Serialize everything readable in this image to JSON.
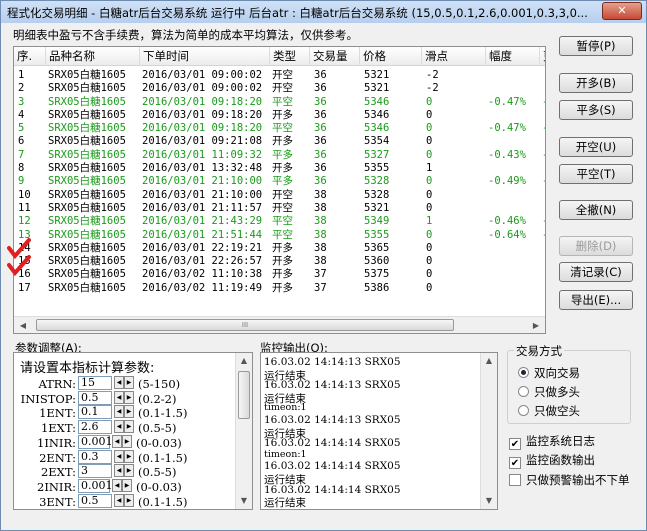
{
  "window": {
    "title": "程式化交易明细 - 白糖atr后台交易系统 运行中 后台atr : 白糖atr后台交易系统 (15,0.5,0.1,2.6,0.001,0.3,3,0...",
    "close": "✕"
  },
  "note": "明细表中盈亏不含手续费，算法为简单的成本平均算法，仅供参考。",
  "table": {
    "headers": [
      "序.",
      "品种名称",
      "下单时间",
      "类型",
      "交易量",
      "价格",
      "滑点",
      "幅度",
      "更"
    ],
    "rows": [
      {
        "n": "1",
        "name": "SRX05白糖1605",
        "time": "2016/03/01 09:00:02",
        "type": "开空",
        "qty": "36",
        "price": "5321",
        "slip": "-2",
        "pct": "",
        "green": false
      },
      {
        "n": "2",
        "name": "SRX05白糖1605",
        "time": "2016/03/01 09:00:02",
        "type": "开空",
        "qty": "36",
        "price": "5321",
        "slip": "-2",
        "pct": "",
        "green": false
      },
      {
        "n": "3",
        "name": "SRX05白糖1605",
        "time": "2016/03/01 09:18:20",
        "type": "平空",
        "qty": "36",
        "price": "5346",
        "slip": "0",
        "pct": "-0.47%",
        "green": true
      },
      {
        "n": "4",
        "name": "SRX05白糖1605",
        "time": "2016/03/01 09:18:20",
        "type": "开多",
        "qty": "36",
        "price": "5346",
        "slip": "0",
        "pct": "",
        "green": false
      },
      {
        "n": "5",
        "name": "SRX05白糖1605",
        "time": "2016/03/01 09:18:20",
        "type": "平空",
        "qty": "36",
        "price": "5346",
        "slip": "0",
        "pct": "-0.47%",
        "green": true
      },
      {
        "n": "6",
        "name": "SRX05白糖1605",
        "time": "2016/03/01 09:21:08",
        "type": "开多",
        "qty": "36",
        "price": "5354",
        "slip": "0",
        "pct": "",
        "green": false
      },
      {
        "n": "7",
        "name": "SRX05白糖1605",
        "time": "2016/03/01 11:09:32",
        "type": "平多",
        "qty": "36",
        "price": "5327",
        "slip": "0",
        "pct": "-0.43%",
        "green": true
      },
      {
        "n": "8",
        "name": "SRX05白糖1605",
        "time": "2016/03/01 13:32:48",
        "type": "开多",
        "qty": "36",
        "price": "5355",
        "slip": "1",
        "pct": "",
        "green": false
      },
      {
        "n": "9",
        "name": "SRX05白糖1605",
        "time": "2016/03/01 21:10:00",
        "type": "平多",
        "qty": "36",
        "price": "5328",
        "slip": "0",
        "pct": "-0.49%",
        "green": true
      },
      {
        "n": "10",
        "name": "SRX05白糖1605",
        "time": "2016/03/01 21:10:00",
        "type": "开空",
        "qty": "38",
        "price": "5328",
        "slip": "0",
        "pct": "",
        "green": false
      },
      {
        "n": "11",
        "name": "SRX05白糖1605",
        "time": "2016/03/01 21:11:57",
        "type": "开空",
        "qty": "38",
        "price": "5321",
        "slip": "0",
        "pct": "",
        "green": false
      },
      {
        "n": "12",
        "name": "SRX05白糖1605",
        "time": "2016/03/01 21:43:29",
        "type": "平空",
        "qty": "38",
        "price": "5349",
        "slip": "1",
        "pct": "-0.46%",
        "green": true
      },
      {
        "n": "13",
        "name": "SRX05白糖1605",
        "time": "2016/03/01 21:51:44",
        "type": "平空",
        "qty": "38",
        "price": "5355",
        "slip": "0",
        "pct": "-0.64%",
        "green": true
      },
      {
        "n": "14",
        "name": "SRX05白糖1605",
        "time": "2016/03/01 22:19:21",
        "type": "开多",
        "qty": "38",
        "price": "5365",
        "slip": "0",
        "pct": "",
        "green": false
      },
      {
        "n": "15",
        "name": "SRX05白糖1605",
        "time": "2016/03/01 22:26:57",
        "type": "开多",
        "qty": "38",
        "price": "5360",
        "slip": "0",
        "pct": "",
        "green": false
      },
      {
        "n": "16",
        "name": "SRX05白糖1605",
        "time": "2016/03/02 11:10:38",
        "type": "开多",
        "qty": "37",
        "price": "5375",
        "slip": "0",
        "pct": "",
        "green": false
      },
      {
        "n": "17",
        "name": "SRX05白糖1605",
        "time": "2016/03/02 11:19:49",
        "type": "开多",
        "qty": "37",
        "price": "5386",
        "slip": "0",
        "pct": "",
        "green": false
      }
    ]
  },
  "buttons": {
    "pause": "暂停(P)",
    "open_long": "开多(B)",
    "close_long": "平多(S)",
    "open_short": "开空(U)",
    "close_short": "平空(T)",
    "cancel_all": "全撤(N)",
    "delete": "删除(D)",
    "clear_log": "清记录(C)",
    "export": "导出(E)..."
  },
  "params": {
    "label": "参数调整(A):",
    "title": "请设置本指标计算参数:",
    "rows": [
      {
        "name": "ATRN:",
        "value": "15",
        "range": "(5-150)"
      },
      {
        "name": "INISTOP:",
        "value": "0.5",
        "range": "(0.2-2)"
      },
      {
        "name": "1ENT:",
        "value": "0.1",
        "range": "(0.1-1.5)"
      },
      {
        "name": "1EXT:",
        "value": "2.6",
        "range": "(0.5-5)"
      },
      {
        "name": "1INIR:",
        "value": "0.001",
        "range": "(0-0.03)"
      },
      {
        "name": "2ENT:",
        "value": "0.3",
        "range": "(0.1-1.5)"
      },
      {
        "name": "2EXT:",
        "value": "3",
        "range": "(0.5-5)"
      },
      {
        "name": "2INIR:",
        "value": "0.001",
        "range": "(0-0.03)"
      },
      {
        "name": "3ENT:",
        "value": "0.5",
        "range": "(0.1-1.5)"
      }
    ]
  },
  "monitor": {
    "label": "监控输出(O):",
    "lines": [
      {
        "text": "16.03.02 14:14:13 SRX05",
        "small": false
      },
      {
        "text": "运行结束",
        "small": false
      },
      {
        "text": "16.03.02 14:14:13 SRX05",
        "small": false
      },
      {
        "text": "运行结束",
        "small": false
      },
      {
        "text": "timeon:1",
        "small": true
      },
      {
        "text": "16.03.02 14:14:13 SRX05",
        "small": false
      },
      {
        "text": "运行结束",
        "small": false
      },
      {
        "text": "16.03.02 14:14:14 SRX05",
        "small": false
      },
      {
        "text": "timeon:1",
        "small": true
      },
      {
        "text": "16.03.02 14:14:14 SRX05",
        "small": false
      },
      {
        "text": "运行结束",
        "small": false
      },
      {
        "text": "16.03.02 14:14:14 SRX05",
        "small": false
      },
      {
        "text": "运行结束",
        "small": false
      }
    ]
  },
  "trade_mode": {
    "legend": "交易方式",
    "options": [
      {
        "label": "双向交易",
        "checked": true
      },
      {
        "label": "只做多头",
        "checked": false
      },
      {
        "label": "只做空头",
        "checked": false
      }
    ]
  },
  "checkboxes": [
    {
      "label": "监控系统日志",
      "checked": true
    },
    {
      "label": "监控函数输出",
      "checked": true
    },
    {
      "label": "只做预警输出不下单",
      "checked": false
    }
  ],
  "colors": {
    "profit_loss_row": "#1a9a1a",
    "annotation": "#e02020"
  }
}
